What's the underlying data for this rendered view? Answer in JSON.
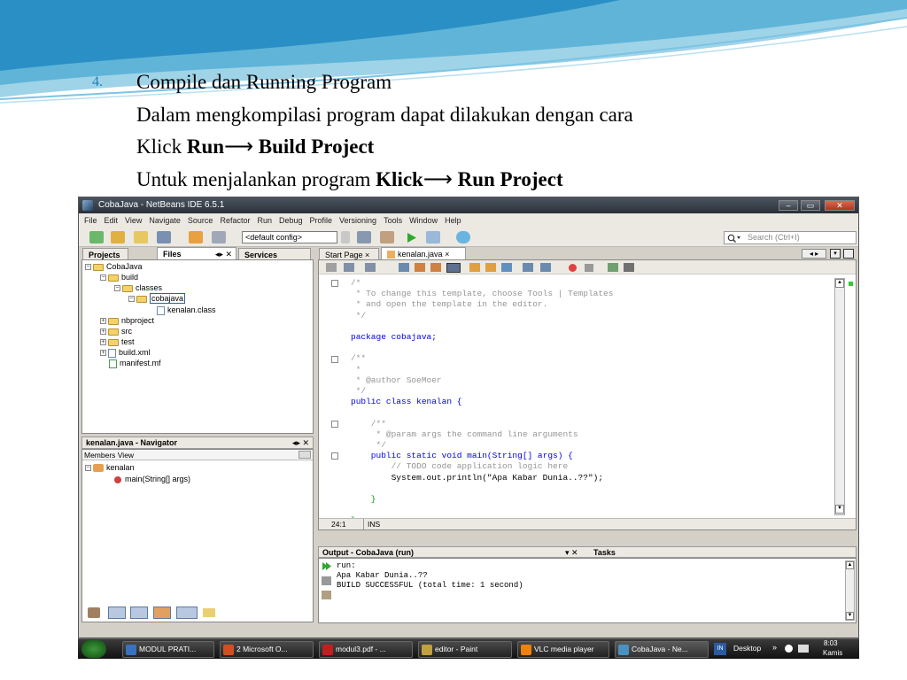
{
  "slide": {
    "item_number": "4.",
    "line1": "Compile dan Running Program",
    "line2": "Dalam mengkompilasi program dapat dilakukan dengan  cara",
    "line3_prefix": "Klick ",
    "line3_bold1": "Run",
    "line3_arrow": "⟶",
    "line3_bold2": "Build Project",
    "line4_prefix": "Untuk menjalankan program ",
    "line4_bold1": "Klick",
    "line4_arrow": "⟶",
    "line4_bold2": "Run Project"
  },
  "window": {
    "title": "CobaJava - NetBeans IDE 6.5.1",
    "controls": [
      "–",
      "▭",
      "✕"
    ]
  },
  "menu": [
    "File",
    "Edit",
    "View",
    "Navigate",
    "Source",
    "Refactor",
    "Run",
    "Debug",
    "Profile",
    "Versioning",
    "Tools",
    "Window",
    "Help"
  ],
  "toolbar": {
    "config": "<default config>",
    "search_placeholder": "Search (Ctrl+I)"
  },
  "projects_panel": {
    "tabs": [
      "Projects",
      "Files",
      "Services"
    ],
    "tree": [
      "CobaJava",
      "build",
      "classes",
      "cobajava",
      "kenalan.class",
      "nbproject",
      "src",
      "test",
      "build.xml",
      "manifest.mf"
    ]
  },
  "navigator": {
    "title": "kenalan.java - Navigator",
    "view": "Members View",
    "items": [
      "kenalan",
      "main(String[] args)"
    ]
  },
  "editor": {
    "tabs": [
      "Start Page",
      "kenalan.java"
    ],
    "status_pos": "24:1",
    "status_mode": "INS",
    "lines": [
      "/*",
      " * To change this template, choose Tools | Templates",
      " * and open the template in the editor.",
      " */",
      "",
      "package cobajava;",
      "",
      "/**",
      " *",
      " * @author SoeMoer",
      " */",
      "public class kenalan {",
      "",
      "    /**",
      "     * @param args the command line arguments",
      "     */",
      "    public static void main(String[] args) {",
      "        // TODO code application logic here",
      "        System.out.println(\"Apa Kabar Dunia..??\");",
      "",
      "    }",
      "",
      "}"
    ]
  },
  "output": {
    "title": "Output - CobaJava (run)",
    "tasks_tab": "Tasks",
    "lines": [
      "run:",
      "Apa Kabar Dunia..??",
      "BUILD SUCCESSFUL (total time: 1 second)"
    ]
  },
  "taskbar": {
    "items": [
      "MODUL PRATI...",
      "2 Microsoft O...",
      "modul3.pdf - ...",
      "editor - Paint",
      "VLC media player",
      "CobaJava - Ne..."
    ],
    "lang": "IN",
    "desktop": "Desktop",
    "time": "8:03",
    "day": "Kamis"
  },
  "colors": {
    "keyword": "#0000e6",
    "comment": "#969696",
    "string": "#ce7b00",
    "field": "#009900",
    "slide_blue": "#1a7fb8"
  }
}
